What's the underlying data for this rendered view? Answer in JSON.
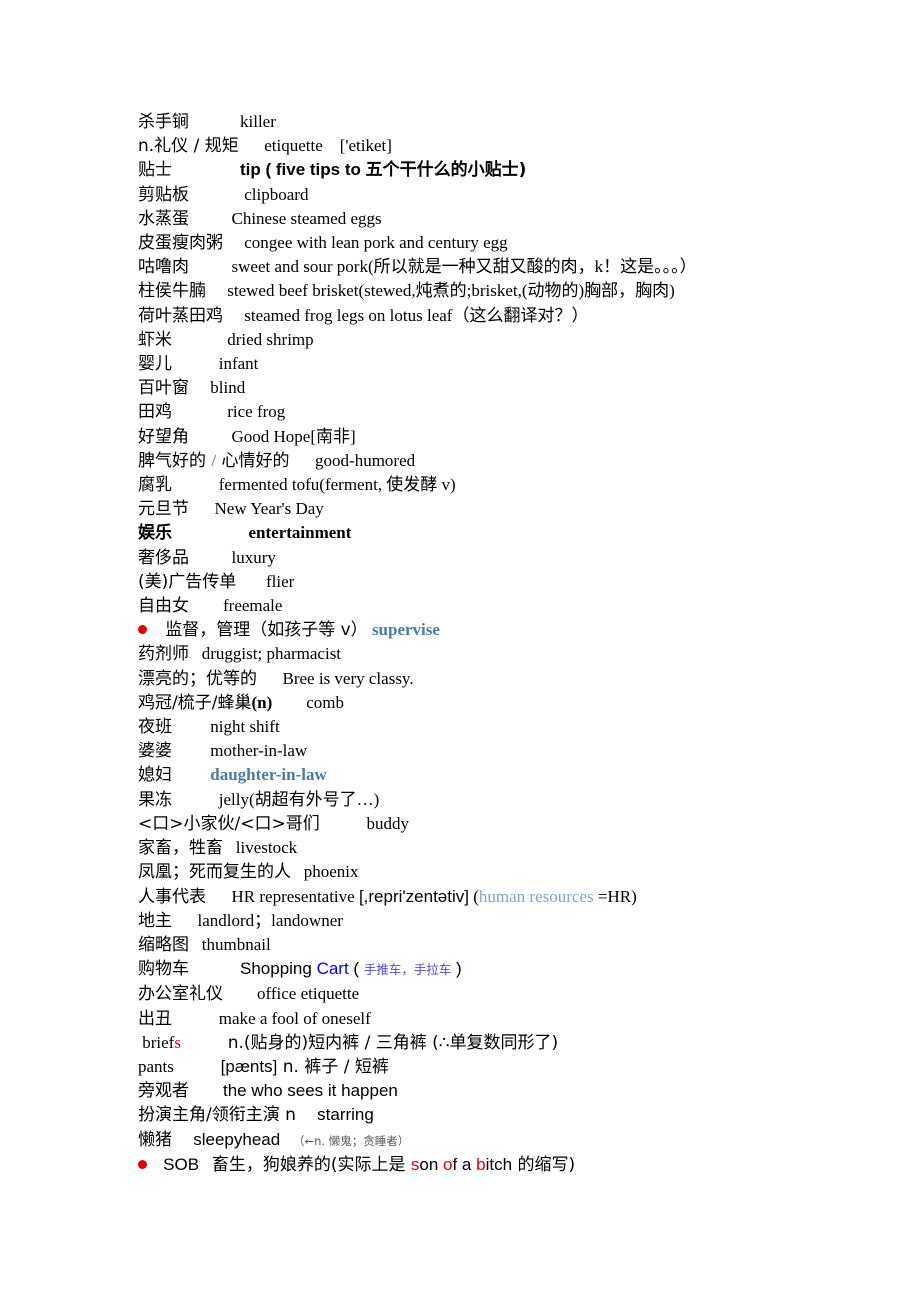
{
  "document": {
    "title": "Chinese-English Vocabulary Notes",
    "background_color": "#ffffff",
    "text_color": "#000000",
    "accent_colors": {
      "red": "#e00000",
      "blue": "#0000ff",
      "steel_blue": "#4a7ba6",
      "light_steel_blue": "#7fa6c6",
      "violet": "#4a4ae0",
      "purple": "#9b3fb5",
      "gray": "#5a5a5a"
    }
  },
  "entries": [
    {
      "id": 1,
      "term": "杀手锏",
      "gap": "            ",
      "definition": "killer"
    },
    {
      "id": 2,
      "term": "n.礼仪 / 规矩",
      "gap": "      ",
      "definition": "etiquette",
      "phonetic": "['etiket]",
      "phonetic_gap": "    "
    },
    {
      "id": 3,
      "term": "贴士",
      "gap": "                ",
      "definition_en": "tip ( five tips to ",
      "definition_cn": "五个干什么的小贴士)",
      "bold": true
    },
    {
      "id": 4,
      "term": "剪贴板",
      "gap": "             ",
      "definition": "clipboard"
    },
    {
      "id": 5,
      "term": "水蒸蛋",
      "gap": "          ",
      "definition": "Chinese steamed eggs"
    },
    {
      "id": 6,
      "term": "皮蛋瘦肉粥",
      "gap": "     ",
      "definition": "congee with lean pork and century egg"
    },
    {
      "id": 7,
      "term": "咕噜肉",
      "gap": "          ",
      "definition": "sweet and sour pork(所以就是一种又甜又酸的肉，k！这是。。。）"
    },
    {
      "id": 8,
      "term": "柱侯牛腩",
      "gap": "     ",
      "definition": "stewed beef brisket(stewed,炖煮的;brisket,(动物的)胸部，胸肉)"
    },
    {
      "id": 9,
      "term": "荷叶蒸田鸡",
      "gap": "     ",
      "definition": "steamed frog legs on lotus leaf（这么翻译对？）"
    },
    {
      "id": 10,
      "term": "虾米",
      "gap": "             ",
      "definition": "dried shrimp"
    },
    {
      "id": 11,
      "term": "婴儿",
      "gap": "           ",
      "definition": "infant"
    },
    {
      "id": 12,
      "term": "百叶窗",
      "gap": "     ",
      "definition": "blind"
    },
    {
      "id": 13,
      "term": "田鸡",
      "gap": "             ",
      "definition": "rice frog"
    },
    {
      "id": 14,
      "term": "好望角",
      "gap": "          ",
      "definition": "Good Hope[南非]"
    },
    {
      "id": 15,
      "term_a": "脾气好的 ",
      "separator": "/",
      "term_b": " 心情好的",
      "gap": "      ",
      "definition": "good-humored"
    },
    {
      "id": 16,
      "term": "腐乳",
      "gap": "           ",
      "definition": "fermented tofu(ferment, 使发酵 v)"
    },
    {
      "id": 17,
      "term": "元旦节",
      "gap": "      ",
      "definition": "New Year's Day"
    },
    {
      "id": 18,
      "term": "娱乐",
      "gap": "                  ",
      "definition": "entertainment",
      "bold": true
    },
    {
      "id": 19,
      "term": "奢侈品",
      "gap": "          ",
      "definition": "luxury"
    },
    {
      "id": 20,
      "term": "(美)广告传单",
      "gap": "       ",
      "definition": "flier"
    },
    {
      "id": 21,
      "term": "自由女",
      "gap": "        ",
      "definition": "freemale"
    },
    {
      "id": 22,
      "bullet": true,
      "term": "   监督，管理（如孩子等 v）",
      "gap": " ",
      "definition": "supervise",
      "definition_color": "steel_blue",
      "bold": true
    },
    {
      "id": 23,
      "term": "药剂师",
      "gap": "   ",
      "definition": "druggist; pharmacist"
    },
    {
      "id": 24,
      "term": "漂亮的；优等的",
      "gap": "      ",
      "definition": "Bree is very classy."
    },
    {
      "id": 25,
      "term": "鸡冠/梳子/蜂巢",
      "term_suffix": "(n)",
      "gap": "        ",
      "definition": "comb"
    },
    {
      "id": 26,
      "term": "夜班",
      "gap": "         ",
      "definition": "night shift"
    },
    {
      "id": 27,
      "term": "婆婆",
      "gap": "         ",
      "definition": "mother-in-law"
    },
    {
      "id": 28,
      "term": "媳妇",
      "gap": "         ",
      "definition": "daughter-in-law",
      "definition_color": "steel_blue",
      "bold": true
    },
    {
      "id": 29,
      "term": "果冻",
      "gap": "           ",
      "definition": "jelly(胡超有外号了…)"
    },
    {
      "id": 30,
      "term": "<口>小家伙/<口>哥们",
      "gap": "           ",
      "definition": "buddy"
    },
    {
      "id": 31,
      "term": "家畜，牲畜",
      "gap": "   ",
      "definition": "livestock"
    },
    {
      "id": 32,
      "term": "凤凰；死而复生的人",
      "gap": "   ",
      "definition": "phoenix"
    },
    {
      "id": 33,
      "term": "人事代表",
      "gap": "      ",
      "definition": "HR representative ",
      "phonetic": "[,repri'zentətiv]",
      "note_open": " (",
      "note_blue": "human resources",
      "note_close": " =HR)"
    },
    {
      "id": 34,
      "term": "地主",
      "gap": "      ",
      "definition": "landlord；landowner"
    },
    {
      "id": 35,
      "term": "缩略图",
      "gap": "   ",
      "definition": "thumbnail"
    },
    {
      "id": 36,
      "term": "购物车",
      "gap": "            ",
      "definition_pre": "Shopping ",
      "definition_hl": "Cart",
      "definition_paren_open": " ( ",
      "definition_note": "手推车，手拉车",
      "definition_paren_close": " )"
    },
    {
      "id": 37,
      "term": "办公室礼仪",
      "gap": "        ",
      "definition": "office etiquette"
    },
    {
      "id": 38,
      "term": "出丑",
      "gap": "           ",
      "definition": "make a fool of oneself"
    },
    {
      "id": 39,
      "term_pre": " brief",
      "term_red": "s",
      "gap": "           ",
      "definition": "n.(贴身的)短内裤 / 三角裤 (∴单复数同形了)"
    },
    {
      "id": 40,
      "term": "pants",
      "gap": "           ",
      "phonetic": "[pænts]",
      "definition": " n. 裤子 / 短裤"
    },
    {
      "id": 41,
      "term": "旁观者",
      "gap": "        ",
      "definition": "the who sees it happen"
    },
    {
      "id": 42,
      "term": "扮演主角/领衔主演 n",
      "gap": "     ",
      "definition": "starring"
    },
    {
      "id": 43,
      "term": "懒猪",
      "gap": "     ",
      "definition": "sleepyhead",
      "note": "（←n. 懒鬼；贪睡者）",
      "note_gap": "   "
    },
    {
      "id": 44,
      "bullet": true,
      "term": "   SOB",
      "gap": "   ",
      "definition_pre": "畜生，狗娘养的(实际上是 ",
      "acronym": [
        {
          "t": "s",
          "red": true
        },
        {
          "t": "on ",
          "red": false
        },
        {
          "t": "o",
          "red": true
        },
        {
          "t": "f a ",
          "red": false
        },
        {
          "t": "b",
          "red": true
        },
        {
          "t": "itch",
          "red": false
        }
      ],
      "definition_post": " 的缩写)"
    }
  ]
}
